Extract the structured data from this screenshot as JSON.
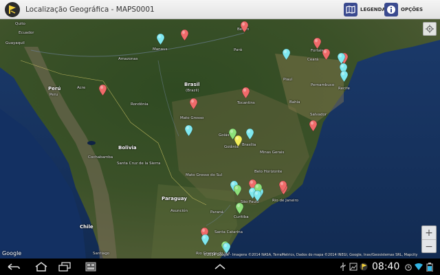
{
  "app": {
    "title": "Localização Geográfica - MAPS0001",
    "icon": "app-logo-icon"
  },
  "actions": {
    "legend_label": "LEGENDA",
    "options_label": "OPÇÕES"
  },
  "map": {
    "labels": {
      "ecuador": "Ecuador",
      "guayaquil": "Guayaquil",
      "quito": "Quito",
      "manaus": "Manaus",
      "amazonas": "Amazonas",
      "belem": "Belém",
      "para": "Pará",
      "fortaleza": "Fortaleza",
      "ceara": "Ceará",
      "piaui": "Piauí",
      "recife": "Recife",
      "pernambuco": "Pernambuco",
      "peru": "Perú",
      "peru_sub": "Peru",
      "acre": "Acre",
      "brasil": "Brasil",
      "brasil_sub": "(Brazil)",
      "rondonia": "Rondônia",
      "tocantins": "Tocantins",
      "bahia": "Bahia",
      "salvador": "Salvador",
      "mato_grosso": "Mato Grosso",
      "goias": "Goiás",
      "goiania": "Goiânia",
      "brasilia": "Brasília",
      "minas": "Minas Gerais",
      "belo_horizonte": "Belo Horizonte",
      "bolivia": "Bolivia",
      "cochabamba": "Cochabamba",
      "santa_cruz": "Santa Cruz de la Sierra",
      "mato_grosso_sul": "Mato Grosso do Sul",
      "sao_paulo": "São Paulo",
      "rio": "Rio de Janeiro",
      "paraguay": "Paraguay",
      "asuncion": "Asunción",
      "parana": "Paraná",
      "curitiba": "Curitiba",
      "santa_catarina": "Santa Catarina",
      "chile": "Chile",
      "rio_grande_sul": "Rio Grande do Sul",
      "santiago": "Santiago"
    },
    "pins": [
      {
        "color": "#f06a6a"
      },
      {
        "color": "#7fe8ef"
      },
      {
        "color": "#f06a6a"
      },
      {
        "color": "#f06a6a"
      },
      {
        "color": "#f06a6a"
      },
      {
        "color": "#7fe8ef"
      },
      {
        "color": "#f06a6a"
      },
      {
        "color": "#7fe8ef"
      },
      {
        "color": "#7fe8ef"
      },
      {
        "color": "#7fe8ef"
      },
      {
        "color": "#f06a6a"
      },
      {
        "color": "#f06a6a"
      },
      {
        "color": "#f06a6a"
      },
      {
        "color": "#7fe8ef"
      },
      {
        "color": "#f06a6a"
      },
      {
        "color": "#8de07a"
      },
      {
        "color": "#7fe8ef"
      },
      {
        "color": "#f2ee5a"
      },
      {
        "color": "#7fe8ef"
      },
      {
        "color": "#8de07a"
      },
      {
        "color": "#f06a6a"
      },
      {
        "color": "#7fe8ef"
      },
      {
        "color": "#7fe8ef"
      },
      {
        "color": "#8de07a"
      },
      {
        "color": "#7fe8ef"
      },
      {
        "color": "#f06a6a"
      },
      {
        "color": "#f06a6a"
      },
      {
        "color": "#8de07a"
      },
      {
        "color": "#f06a6a"
      },
      {
        "color": "#7fe8ef"
      },
      {
        "color": "#8de07a"
      },
      {
        "color": "#7fe8ef"
      }
    ],
    "zoom_in": "+",
    "zoom_out": "−",
    "google": "Google",
    "attribution": "©2014 Google - Imagens ©2014 NASA, TerraMetrics, Dados do mapa ©2014 INEGI, Google, Inav/Geosistemas SRL, Mapcity"
  },
  "status": {
    "time": "08:40"
  }
}
